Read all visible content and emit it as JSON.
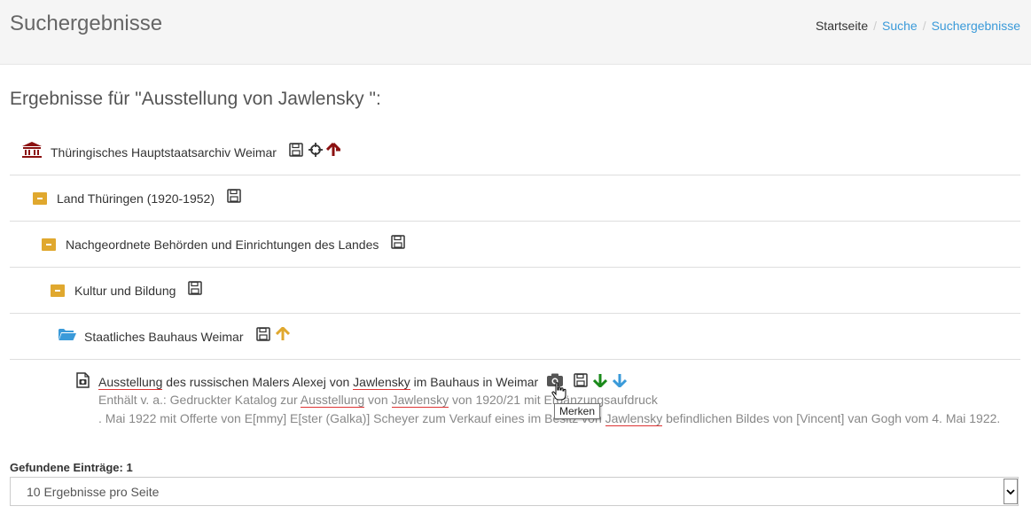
{
  "header": {
    "title": "Suchergebnisse",
    "breadcrumb": {
      "home": "Startseite",
      "search": "Suche",
      "results": "Suchergebnisse"
    }
  },
  "results_heading": "Ergebnisse für \"Ausstellung von Jawlensky \":",
  "tree": [
    {
      "label": "Thüringisches Hauptstaatsarchiv Weimar",
      "icon": "archive-building-icon",
      "color": "#8b1010"
    },
    {
      "label": "Land Thüringen (1920-1952)",
      "icon": "folder-closed-icon",
      "color": "#e0a82e"
    },
    {
      "label": "Nachgeordnete Behörden und Einrichtungen des Landes",
      "icon": "folder-closed-icon",
      "color": "#e0a82e"
    },
    {
      "label": "Kultur und Bildung",
      "icon": "folder-closed-icon",
      "color": "#e0a82e"
    },
    {
      "label": "Staatliches Bauhaus Weimar",
      "icon": "folder-open-icon",
      "color": "#3a9ad9"
    }
  ],
  "result": {
    "title_parts": [
      "Ausstellung",
      " des russischen Malers Alexej von ",
      "Jawlensky",
      " im Bauhaus in Weimar"
    ],
    "desc_line1_parts": [
      "Enthält v. a.: Gedruckter Katalog zur ",
      "Ausstellung",
      " von ",
      "Jawlensky",
      " von 1920/21 mit Ergänzungsaufdruck"
    ],
    "desc_line2_parts": [
      ". Mai 1922 mit Offerte von E[mmy] E[ster (Galka)] Scheyer zum Verkauf eines im Besitz von ",
      "Jawlensky",
      " befindlichen Bildes von [Vincent] van Gogh vom 4. Mai 1922."
    ]
  },
  "tooltip": "Merken",
  "found_label": "Gefundene Einträge: 1",
  "page_size_select": {
    "value": "10 Ergebnisse pro Seite"
  },
  "colors": {
    "arrow_up_red": "#8b1010",
    "arrow_up_orange": "#e0a82e",
    "arrow_down_green": "#1a8a1a",
    "arrow_down_blue": "#3a9ad9",
    "link": "#3a9ad9"
  }
}
